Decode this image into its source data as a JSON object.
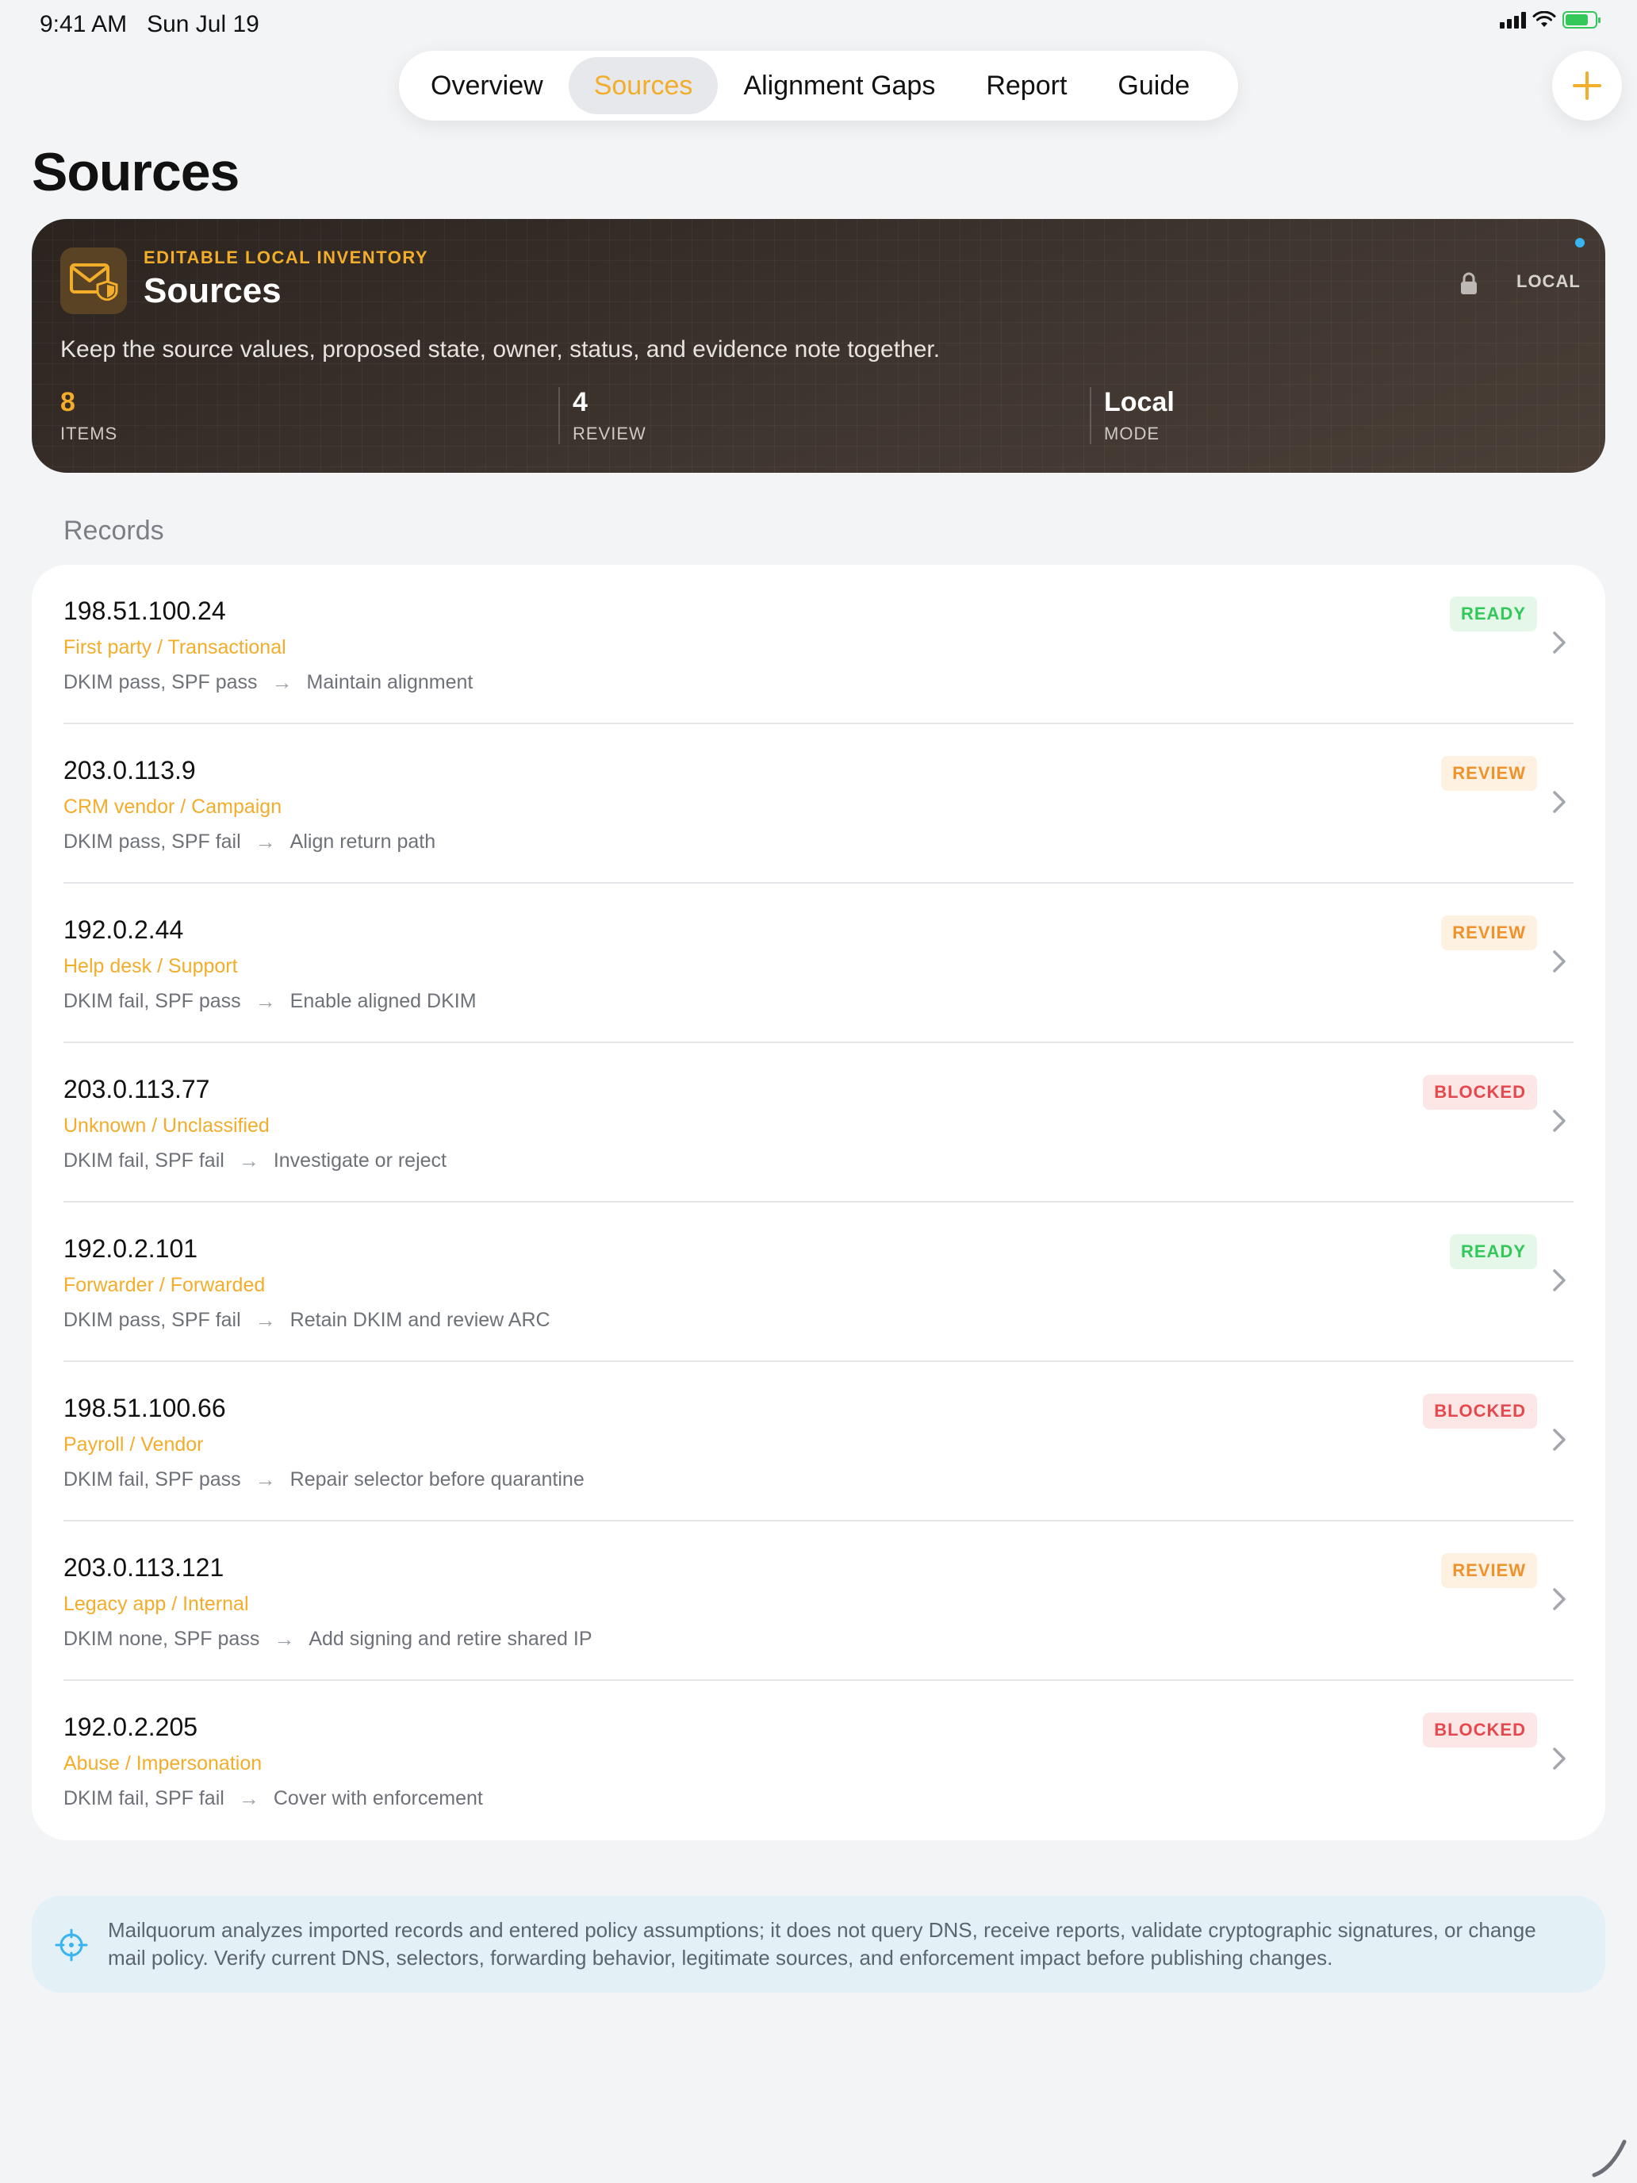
{
  "status_bar": {
    "time": "9:41 AM",
    "date": "Sun Jul 19"
  },
  "nav": {
    "tabs": [
      {
        "label": "Overview",
        "active": false
      },
      {
        "label": "Sources",
        "active": true
      },
      {
        "label": "Alignment Gaps",
        "active": false
      },
      {
        "label": "Report",
        "active": false
      },
      {
        "label": "Guide",
        "active": false
      }
    ],
    "add_icon": "plus-icon"
  },
  "page": {
    "title": "Sources"
  },
  "hero": {
    "icon": "envelope-shield-icon",
    "eyebrow": "EDITABLE LOCAL INVENTORY",
    "title": "Sources",
    "mode_badge": "LOCAL",
    "description": "Keep the source values, proposed state, owner, status, and evidence note together.",
    "stats": [
      {
        "value": "8",
        "label": "ITEMS"
      },
      {
        "value": "4",
        "label": "REVIEW"
      },
      {
        "value": "Local",
        "label": "MODE"
      }
    ]
  },
  "records_section": {
    "label": "Records"
  },
  "records": [
    {
      "ip": "198.51.100.24",
      "category": "First party / Transactional",
      "checks": "DKIM pass, SPF pass",
      "action": "Maintain alignment",
      "status": "READY",
      "status_kind": "ready"
    },
    {
      "ip": "203.0.113.9",
      "category": "CRM vendor / Campaign",
      "checks": "DKIM pass, SPF fail",
      "action": "Align return path",
      "status": "REVIEW",
      "status_kind": "review"
    },
    {
      "ip": "192.0.2.44",
      "category": "Help desk / Support",
      "checks": "DKIM fail, SPF pass",
      "action": "Enable aligned DKIM",
      "status": "REVIEW",
      "status_kind": "review"
    },
    {
      "ip": "203.0.113.77",
      "category": "Unknown / Unclassified",
      "checks": "DKIM fail, SPF fail",
      "action": "Investigate or reject",
      "status": "BLOCKED",
      "status_kind": "blocked"
    },
    {
      "ip": "192.0.2.101",
      "category": "Forwarder / Forwarded",
      "checks": "DKIM pass, SPF fail",
      "action": "Retain DKIM and review ARC",
      "status": "READY",
      "status_kind": "ready"
    },
    {
      "ip": "198.51.100.66",
      "category": "Payroll / Vendor",
      "checks": "DKIM fail, SPF pass",
      "action": "Repair selector before quarantine",
      "status": "BLOCKED",
      "status_kind": "blocked"
    },
    {
      "ip": "203.0.113.121",
      "category": "Legacy app / Internal",
      "checks": "DKIM none, SPF pass",
      "action": "Add signing and retire shared IP",
      "status": "REVIEW",
      "status_kind": "review"
    },
    {
      "ip": "192.0.2.205",
      "category": "Abuse / Impersonation",
      "checks": "DKIM fail, SPF fail",
      "action": "Cover with enforcement",
      "status": "BLOCKED",
      "status_kind": "blocked"
    }
  ],
  "disclaimer": {
    "icon": "crosshair-icon",
    "text": "Mailquorum analyzes imported records and entered policy assumptions; it does not query DNS, receive reports, validate cryptographic signatures, or change mail policy. Verify current DNS, selectors, forwarding behavior, legitimate sources, and enforcement impact before publishing changes."
  },
  "colors": {
    "accent": "#f2ad2b",
    "ready": "#34c759",
    "review": "#f0922b",
    "blocked": "#e5484d",
    "background": "#f3f4f6"
  }
}
